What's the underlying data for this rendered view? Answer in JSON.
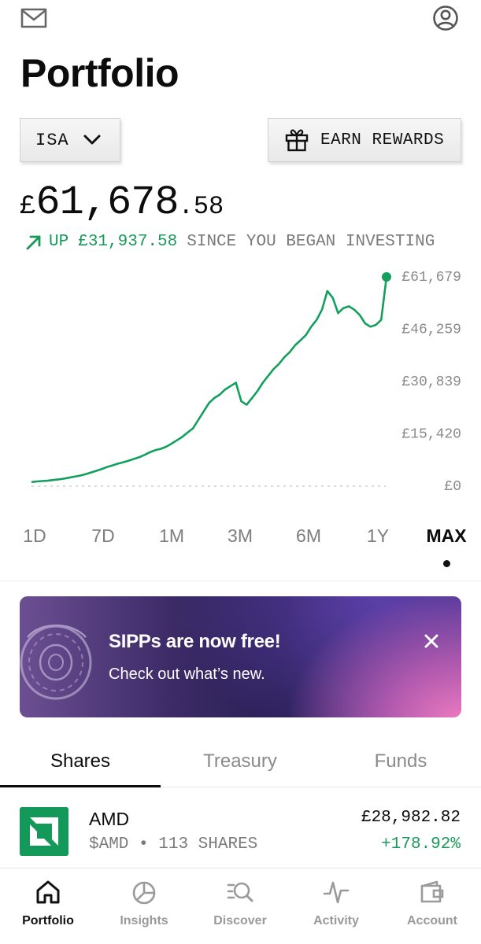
{
  "header": {
    "mail_icon": "mail-icon",
    "profile_icon": "profile-icon",
    "title": "Portfolio"
  },
  "account_selector": {
    "label": "ISA",
    "icon": "chevron-down-icon"
  },
  "rewards_button": {
    "label": "EARN REWARDS",
    "icon": "gift-icon"
  },
  "balance": {
    "currency": "£",
    "whole": "61,678",
    "decimal": ".58"
  },
  "gain": {
    "direction": "UP",
    "amount": "£31,937.58",
    "suffix": "SINCE YOU BEGAN INVESTING",
    "color": "#1a9a5a"
  },
  "chart_data": {
    "type": "line",
    "ytick_labels": [
      "£61,679",
      "£46,259",
      "£30,839",
      "£15,420",
      "£0"
    ],
    "ylim": [
      0,
      61679
    ],
    "x_range_label": "MAX",
    "line_color": "#12a05c",
    "series": [
      {
        "values": [
          1200,
          1400,
          1500,
          1600,
          1800,
          2000,
          2200,
          2500,
          2800,
          3100,
          3500,
          4000,
          4500,
          5000,
          5600,
          6100,
          6600,
          7000,
          7500,
          8000,
          8500,
          9200,
          10000,
          10600,
          11000,
          11600,
          12500,
          13500,
          14500,
          15800,
          17000,
          19500,
          22000,
          24500,
          26000,
          27000,
          28500,
          29500,
          30500,
          25000,
          24000,
          26000,
          28000,
          30500,
          32500,
          34500,
          36000,
          38000,
          39500,
          41500,
          43000,
          44500,
          47000,
          49000,
          52000,
          57500,
          55500,
          51000,
          52500,
          53000,
          52000,
          50500,
          48000,
          47000,
          47500,
          49000,
          61679
        ]
      }
    ]
  },
  "time_ranges": [
    {
      "label": "1D",
      "active": false
    },
    {
      "label": "7D",
      "active": false
    },
    {
      "label": "1M",
      "active": false
    },
    {
      "label": "3M",
      "active": false
    },
    {
      "label": "6M",
      "active": false
    },
    {
      "label": "1Y",
      "active": false
    },
    {
      "label": "MAX",
      "active": true
    }
  ],
  "promo_banner": {
    "title": "SIPPs are now free!",
    "subtitle": "Check out what’s new.",
    "close_icon": "close-icon"
  },
  "tabs": [
    {
      "label": "Shares",
      "active": true
    },
    {
      "label": "Treasury",
      "active": false
    },
    {
      "label": "Funds",
      "active": false
    }
  ],
  "holdings": [
    {
      "name": "AMD",
      "ticker": "$AMD",
      "shares": "113 SHARES",
      "separator": "•",
      "value": "£28,982.82",
      "change": "+178.92%",
      "logo": "amd-logo",
      "logo_color": "#139a5a"
    }
  ],
  "bottom_nav": [
    {
      "label": "Portfolio",
      "icon": "home-icon",
      "active": true
    },
    {
      "label": "Insights",
      "icon": "pie-chart-icon",
      "active": false
    },
    {
      "label": "Discover",
      "icon": "discover-search-icon",
      "active": false
    },
    {
      "label": "Activity",
      "icon": "activity-pulse-icon",
      "active": false
    },
    {
      "label": "Account",
      "icon": "wallet-icon",
      "active": false
    }
  ]
}
